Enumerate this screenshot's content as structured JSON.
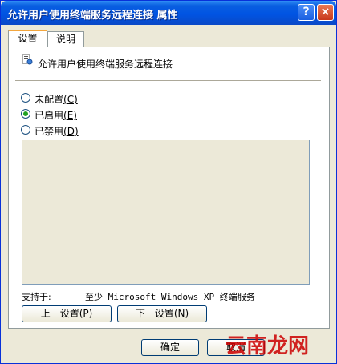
{
  "window": {
    "title": "允许用户使用终端服务远程连接 属性",
    "help_label": "?",
    "close_label": "×"
  },
  "tabs": [
    {
      "label": "设置"
    },
    {
      "label": "说明"
    }
  ],
  "policy": {
    "label": "允许用户使用终端服务远程连接"
  },
  "options": [
    {
      "label": "未配置",
      "key": "(C)"
    },
    {
      "label": "已启用",
      "key": "(E)"
    },
    {
      "label": "已禁用",
      "key": "(D)"
    }
  ],
  "selected_option": "已启用",
  "support": {
    "label": "支持于:",
    "value": "至少 Microsoft Windows XP 终端服务"
  },
  "nav": {
    "prev": "上一设置(P)",
    "next": "下一设置(N)"
  },
  "footer": {
    "ok": "确定",
    "cancel": "取消"
  },
  "watermark": "云南龙网",
  "colors": {
    "titlebar": "#0054e3",
    "radio_checked": "#21a121",
    "tab_highlight": "#f3a63d"
  }
}
